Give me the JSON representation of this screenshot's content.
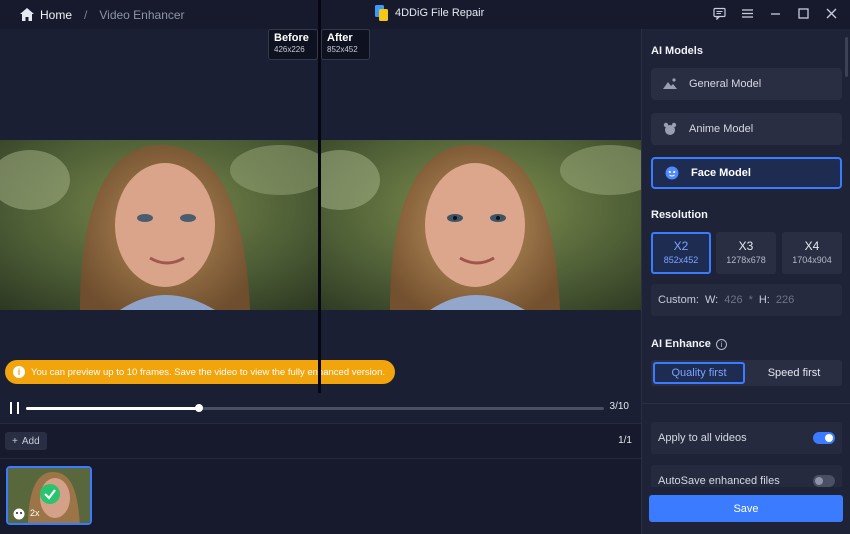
{
  "titlebar": {
    "home": "Home",
    "separator": "/",
    "page": "Video Enhancer",
    "app_name": "4DDiG File Repair"
  },
  "preview": {
    "before_label": "Before",
    "before_res": "426x226",
    "after_label": "After",
    "after_res": "852x452",
    "notice": "You can preview up to 10 frames. Save the video to view the fully enhanced version."
  },
  "playback": {
    "progress": 0.3,
    "frame_text": "3/10"
  },
  "files": {
    "add_label": "Add",
    "page_text": "1/1",
    "thumb_scale": "2x"
  },
  "panel": {
    "models_title": "AI Models",
    "models": [
      "General Model",
      "Anime Model",
      "Face Model"
    ],
    "selected_model": "Face Model",
    "resolution_title": "Resolution",
    "resolutions": [
      {
        "scale": "X2",
        "size": "852x452"
      },
      {
        "scale": "X3",
        "size": "1278x678"
      },
      {
        "scale": "X4",
        "size": "1704x904"
      }
    ],
    "selected_resolution": "X2",
    "custom_label": "Custom:",
    "w_label": "W:",
    "w_value": "426",
    "mult": "*",
    "h_label": "H:",
    "h_value": "226",
    "enhance_title": "AI Enhance",
    "enhance_options": [
      "Quality first",
      "Speed first"
    ],
    "selected_enhance": "Quality first",
    "apply_all": "Apply to all videos",
    "apply_all_on": true,
    "autosave": "AutoSave enhanced files",
    "autosave_on": false,
    "save_label": "Save"
  },
  "colors": {
    "accent": "#3a7bff",
    "notice": "#f2a40c",
    "success": "#2ac46e"
  }
}
